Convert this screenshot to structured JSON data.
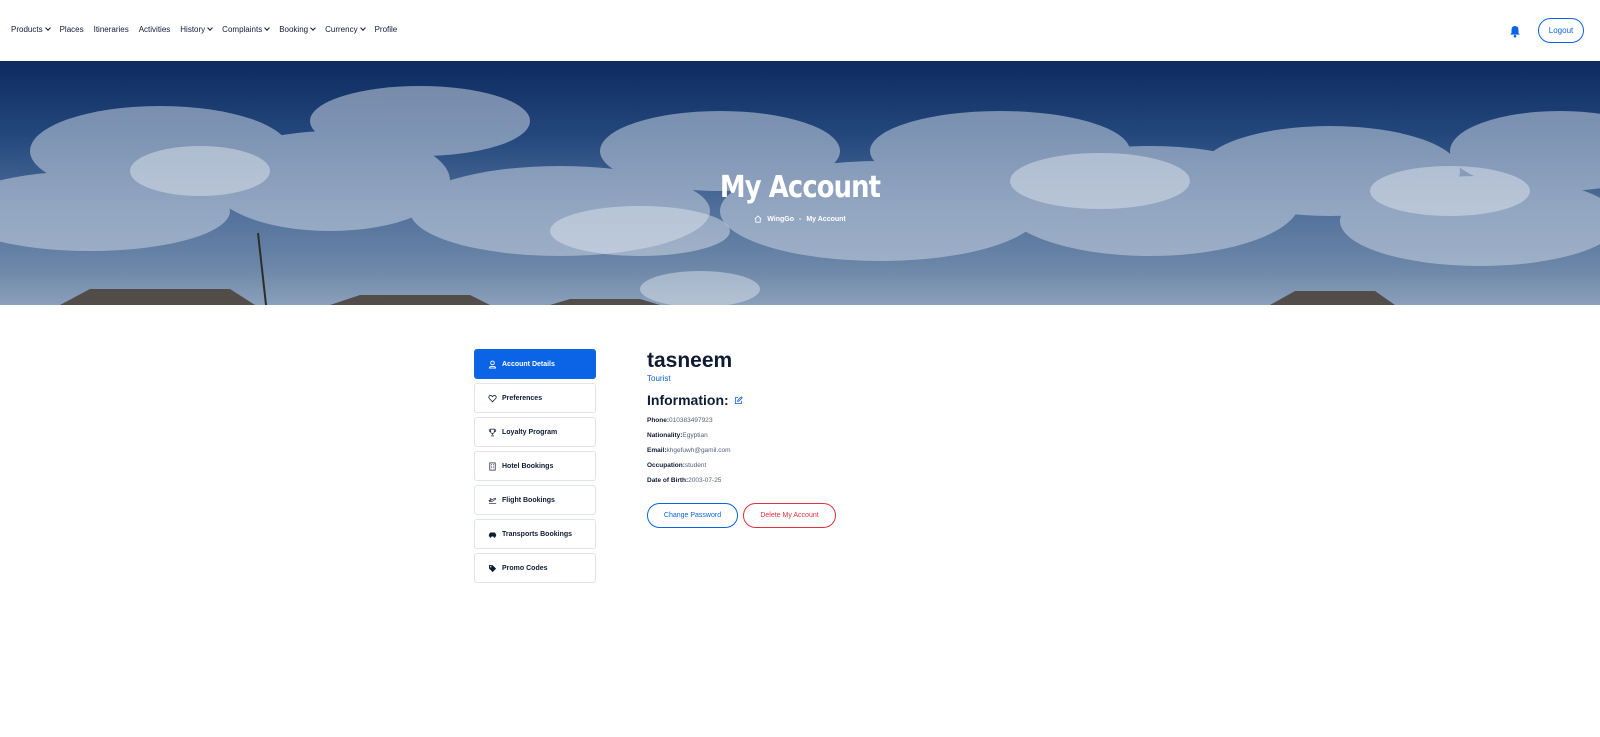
{
  "nav": {
    "items": [
      {
        "label": "Products",
        "dropdown": true
      },
      {
        "label": "Places",
        "dropdown": false
      },
      {
        "label": "Itineraries",
        "dropdown": false
      },
      {
        "label": "Activities",
        "dropdown": false
      },
      {
        "label": "History",
        "dropdown": true
      },
      {
        "label": "Complaints",
        "dropdown": true
      },
      {
        "label": "Booking",
        "dropdown": true
      },
      {
        "label": "Currency",
        "dropdown": true
      },
      {
        "label": "Profile",
        "dropdown": false
      }
    ],
    "logout_label": "Logout",
    "bell_icon": "bell-icon"
  },
  "hero": {
    "title": "My Account",
    "breadcrumb_home": "WingGo",
    "breadcrumb_separator": "-",
    "breadcrumb_current": "My Account"
  },
  "sidebar": {
    "items": [
      {
        "label": "Account Details",
        "icon": "user-icon",
        "active": true
      },
      {
        "label": "Preferences",
        "icon": "heart-icon",
        "active": false
      },
      {
        "label": "Loyalty Program",
        "icon": "trophy-icon",
        "active": false
      },
      {
        "label": "Hotel Bookings",
        "icon": "building-icon",
        "active": false
      },
      {
        "label": "Flight Bookings",
        "icon": "plane-icon",
        "active": false
      },
      {
        "label": "Transports Bookings",
        "icon": "car-icon",
        "active": false
      },
      {
        "label": "Promo Codes",
        "icon": "tag-icon",
        "active": false
      }
    ]
  },
  "profile": {
    "username": "tasneem",
    "role": "Tourist",
    "info_title": "Information:",
    "fields": [
      {
        "label": "Phone:",
        "value": "01038349792З"
      },
      {
        "label": "Nationality:",
        "value": "Egyptian"
      },
      {
        "label": "Email:",
        "value": "khgefuwh@gamil.com"
      },
      {
        "label": "Occupation:",
        "value": "student"
      },
      {
        "label": "Date of Birth:",
        "value": "2003-07-25"
      }
    ],
    "change_password_label": "Change Password",
    "delete_account_label": "Delete My Account"
  },
  "colors": {
    "primary": "#0b63e5",
    "danger": "#e0303e",
    "text_dark": "#0f1b33"
  }
}
